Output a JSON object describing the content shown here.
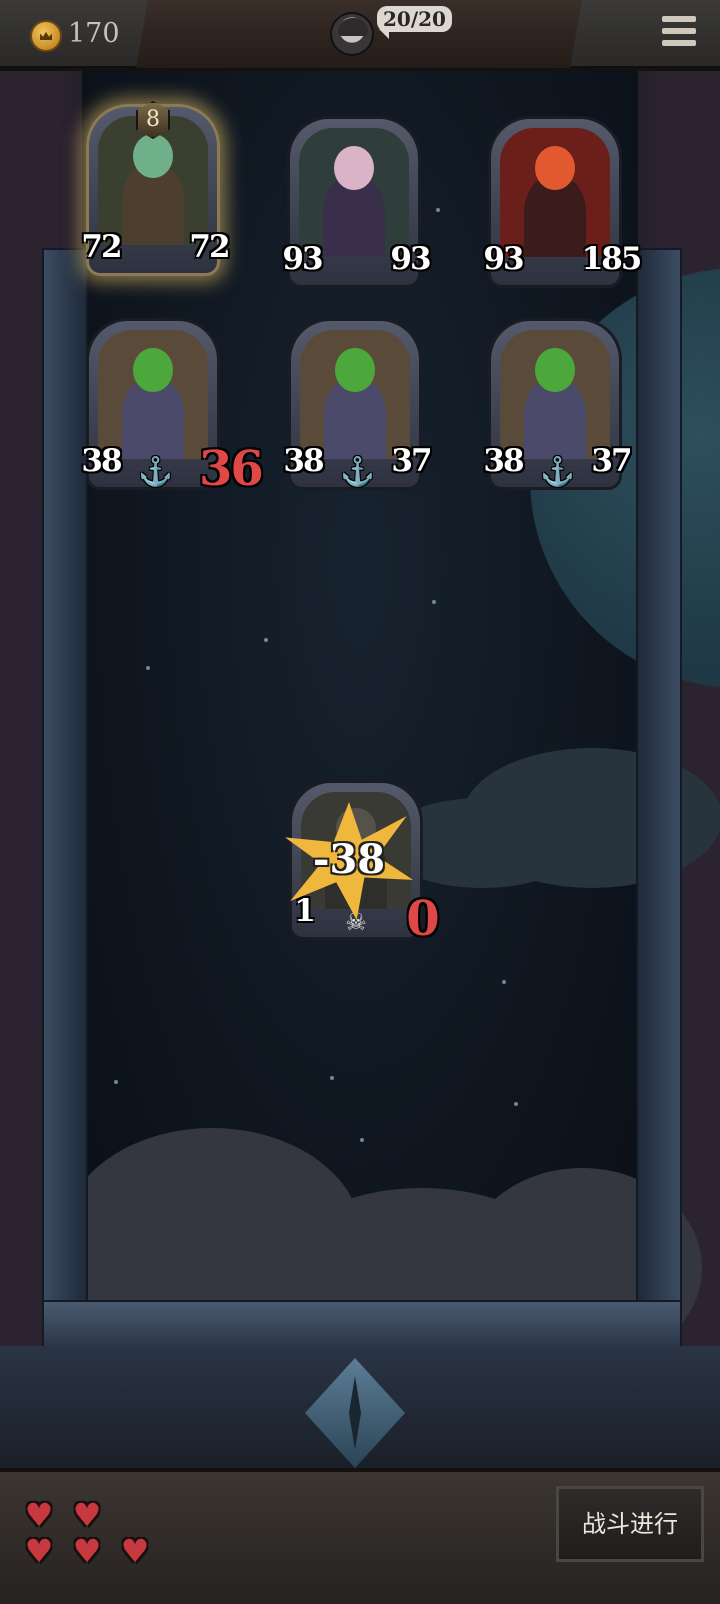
{
  "topbar": {
    "gold": "170",
    "health": "20/20",
    "gold_icon": "crown-coin-icon",
    "menu_icon": "hamburger-menu-icon"
  },
  "enemy_cards": [
    {
      "character": "hooded green zombie",
      "level": "8",
      "attack": "72",
      "health": "72",
      "selected": true
    },
    {
      "character": "witch with green hat",
      "attack": "93",
      "health": "93"
    },
    {
      "character": "fire demon",
      "attack": "93",
      "health": "185"
    },
    {
      "character": "plant creature",
      "attack": "38",
      "health": "36",
      "health_damaged": true,
      "ability_icon": "anchor-sprout-icon"
    },
    {
      "character": "plant creature",
      "attack": "38",
      "health": "37",
      "ability_icon": "anchor-sprout-icon"
    },
    {
      "character": "plant creature",
      "attack": "38",
      "health": "37",
      "ability_icon": "anchor-sprout-icon"
    }
  ],
  "player_card": {
    "attack": "1",
    "health": "0",
    "damage": "-38",
    "ability_icon": "skull-icon"
  },
  "bottombar": {
    "lives": 5,
    "battle_button": "战斗进行"
  },
  "colors": {
    "attack_badge": "#2f4f7a",
    "health_badge": "#7a2a2e",
    "damage_text": "#e04848",
    "burst": "#efb73c",
    "heart": "#c7383f"
  }
}
